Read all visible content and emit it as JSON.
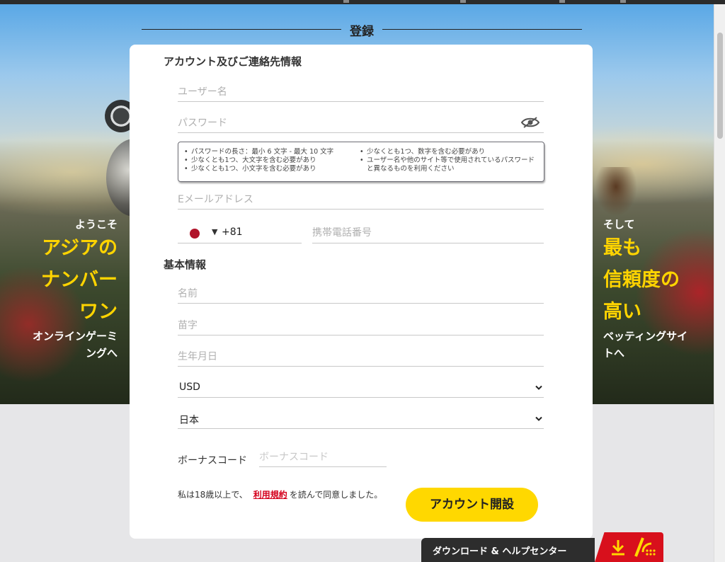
{
  "page": {
    "title": "登録"
  },
  "promo": {
    "left": {
      "small": "ようこそ",
      "big": [
        "アジアの",
        "ナンバー",
        "ワン"
      ],
      "tail": "オンラインゲーミングへ"
    },
    "right": {
      "small": "そして",
      "big": [
        "最も",
        "信頼度の",
        "高い"
      ],
      "tail": "ベッティングサイトへ"
    }
  },
  "account_section": {
    "title": "アカウント及びご連絡先情報",
    "username_placeholder": "ユーザー名",
    "password_placeholder": "パスワード",
    "password_rules_col1": [
      "パスワードの長さ：最小 6 文字 - 最大 10 文字",
      "少なくとも1つ、大文字を含む必要があり",
      "少なくとも1つ、小文字を含む必要があり"
    ],
    "password_rules_col2": [
      "少なくとも1つ、数字を含む必要があり",
      "ユーザー名や他のサイト等で使用されているパスワードと異なるものを利用ください"
    ],
    "email_placeholder": "Eメールアドレス",
    "phone_code": "+81",
    "phone_arrow": "▼",
    "phone_placeholder": "携帯電話番号"
  },
  "basic_section": {
    "title": "基本情報",
    "first_name_placeholder": "名前",
    "last_name_placeholder": "苗字",
    "dob_placeholder": "生年月日",
    "currency": "USD",
    "country": "日本"
  },
  "bonus": {
    "label": "ボーナスコード",
    "placeholder": "ボーナスコード"
  },
  "terms": {
    "before": "私は18歳以上で、",
    "link": "利用規約",
    "after": "を読んで同意しました。"
  },
  "open_account_button": "アカウント開設",
  "help_bar": {
    "label": "ダウンロード & ヘルプセンター"
  },
  "colors": {
    "accent": "#ffd800",
    "promo_yellow": "#ffd400",
    "link_red": "#d4001c",
    "help_red": "#d8101c"
  }
}
